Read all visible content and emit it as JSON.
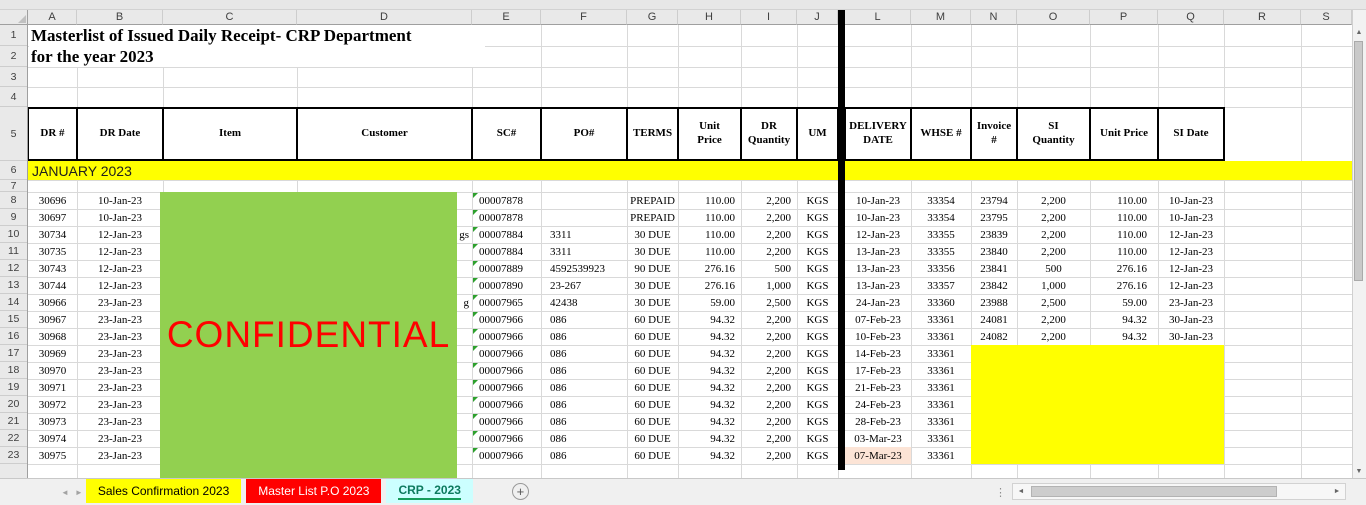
{
  "sheet": {
    "title_line1": "Masterlist of Issued Daily Receipt- CRP Department",
    "title_line2": "for the year 2023",
    "section_header": "JANUARY 2023",
    "confidential_text": "CONFIDENTIAL",
    "column_letters": [
      "A",
      "B",
      "C",
      "D",
      "E",
      "F",
      "G",
      "H",
      "I",
      "J",
      "L",
      "M",
      "N",
      "O",
      "P",
      "Q",
      "R",
      "S"
    ],
    "row_numbers": [
      "1",
      "2",
      "3",
      "4",
      "5",
      "6",
      "7",
      "8",
      "9",
      "10",
      "11",
      "12",
      "13",
      "14",
      "15",
      "16",
      "17",
      "18",
      "19",
      "20",
      "21",
      "22",
      "23"
    ],
    "headers": {
      "dr": "DR #",
      "dr_date": "DR Date",
      "item": "Item",
      "customer": "Customer",
      "sc": "SC#",
      "po": "PO#",
      "terms": "TERMS",
      "unit_price": "Unit\nPrice",
      "dr_qty": "DR\nQuantity",
      "um": "UM",
      "delivery_date": "DELIVERY\nDATE",
      "whse": "WHSE #",
      "invoice": "Invoice\n#",
      "si_qty": "SI\nQuantity",
      "si_unit_price": "Unit Price",
      "si_date": "SI Date"
    },
    "records": [
      {
        "row": "8",
        "dr": "30696",
        "dr_date": "10-Jan-23",
        "sc": "00007878",
        "po": "",
        "terms": "PREPAID",
        "unit_price": "110.00",
        "dr_qty": "2,200",
        "um": "KGS",
        "delivery_date": "10-Jan-23",
        "whse": "33354",
        "invoice": "23794",
        "si_qty": "2,200",
        "si_unit_price": "110.00",
        "si_date": "10-Jan-23"
      },
      {
        "row": "9",
        "dr": "30697",
        "dr_date": "10-Jan-23",
        "sc": "00007878",
        "po": "",
        "terms": "PREPAID",
        "unit_price": "110.00",
        "dr_qty": "2,200",
        "um": "KGS",
        "delivery_date": "10-Jan-23",
        "whse": "33354",
        "invoice": "23795",
        "si_qty": "2,200",
        "si_unit_price": "110.00",
        "si_date": "10-Jan-23"
      },
      {
        "row": "10",
        "dr": "30734",
        "dr_date": "12-Jan-23",
        "customer_tail": "gs",
        "sc": "00007884",
        "po": "3311",
        "terms": "30 DUE",
        "unit_price": "110.00",
        "dr_qty": "2,200",
        "um": "KGS",
        "delivery_date": "12-Jan-23",
        "whse": "33355",
        "invoice": "23839",
        "si_qty": "2,200",
        "si_unit_price": "110.00",
        "si_date": "12-Jan-23"
      },
      {
        "row": "11",
        "dr": "30735",
        "dr_date": "12-Jan-23",
        "sc": "00007884",
        "po": "3311",
        "terms": "30 DUE",
        "unit_price": "110.00",
        "dr_qty": "2,200",
        "um": "KGS",
        "delivery_date": "13-Jan-23",
        "whse": "33355",
        "invoice": "23840",
        "si_qty": "2,200",
        "si_unit_price": "110.00",
        "si_date": "12-Jan-23"
      },
      {
        "row": "12",
        "dr": "30743",
        "dr_date": "12-Jan-23",
        "sc": "00007889",
        "po": "4592539923",
        "terms": "90 DUE",
        "unit_price": "276.16",
        "dr_qty": "500",
        "um": "KGS",
        "delivery_date": "13-Jan-23",
        "whse": "33356",
        "invoice": "23841",
        "si_qty": "500",
        "si_unit_price": "276.16",
        "si_date": "12-Jan-23"
      },
      {
        "row": "13",
        "dr": "30744",
        "dr_date": "12-Jan-23",
        "sc": "00007890",
        "po": "23-267",
        "terms": "30 DUE",
        "unit_price": "276.16",
        "dr_qty": "1,000",
        "um": "KGS",
        "delivery_date": "13-Jan-23",
        "whse": "33357",
        "invoice": "23842",
        "si_qty": "1,000",
        "si_unit_price": "276.16",
        "si_date": "12-Jan-23"
      },
      {
        "row": "14",
        "dr": "30966",
        "dr_date": "23-Jan-23",
        "customer_tail": "g",
        "sc": "00007965",
        "po": "42438",
        "terms": "30 DUE",
        "unit_price": "59.00",
        "dr_qty": "2,500",
        "um": "KGS",
        "delivery_date": "24-Jan-23",
        "whse": "33360",
        "invoice": "23988",
        "si_qty": "2,500",
        "si_unit_price": "59.00",
        "si_date": "23-Jan-23"
      },
      {
        "row": "15",
        "dr": "30967",
        "dr_date": "23-Jan-23",
        "sc": "00007966",
        "po": "086",
        "terms": "60 DUE",
        "unit_price": "94.32",
        "dr_qty": "2,200",
        "um": "KGS",
        "delivery_date": "07-Feb-23",
        "whse": "33361",
        "invoice": "24081",
        "si_qty": "2,200",
        "si_unit_price": "94.32",
        "si_date": "30-Jan-23"
      },
      {
        "row": "16",
        "dr": "30968",
        "dr_date": "23-Jan-23",
        "sc": "00007966",
        "po": "086",
        "terms": "60 DUE",
        "unit_price": "94.32",
        "dr_qty": "2,200",
        "um": "KGS",
        "delivery_date": "10-Feb-23",
        "whse": "33361",
        "invoice": "24082",
        "si_qty": "2,200",
        "si_unit_price": "94.32",
        "si_date": "30-Jan-23"
      },
      {
        "row": "17",
        "dr": "30969",
        "dr_date": "23-Jan-23",
        "sc": "00007966",
        "po": "086",
        "terms": "60 DUE",
        "unit_price": "94.32",
        "dr_qty": "2,200",
        "um": "KGS",
        "delivery_date": "14-Feb-23",
        "whse": "33361",
        "invoice": "",
        "si_qty": "",
        "si_unit_price": "",
        "si_date": ""
      },
      {
        "row": "18",
        "dr": "30970",
        "dr_date": "23-Jan-23",
        "sc": "00007966",
        "po": "086",
        "terms": "60 DUE",
        "unit_price": "94.32",
        "dr_qty": "2,200",
        "um": "KGS",
        "delivery_date": "17-Feb-23",
        "whse": "33361",
        "invoice": "",
        "si_qty": "",
        "si_unit_price": "",
        "si_date": ""
      },
      {
        "row": "19",
        "dr": "30971",
        "dr_date": "23-Jan-23",
        "sc": "00007966",
        "po": "086",
        "terms": "60 DUE",
        "unit_price": "94.32",
        "dr_qty": "2,200",
        "um": "KGS",
        "delivery_date": "21-Feb-23",
        "whse": "33361",
        "invoice": "",
        "si_qty": "",
        "si_unit_price": "",
        "si_date": ""
      },
      {
        "row": "20",
        "dr": "30972",
        "dr_date": "23-Jan-23",
        "sc": "00007966",
        "po": "086",
        "terms": "60 DUE",
        "unit_price": "94.32",
        "dr_qty": "2,200",
        "um": "KGS",
        "delivery_date": "24-Feb-23",
        "whse": "33361",
        "invoice": "",
        "si_qty": "",
        "si_unit_price": "",
        "si_date": ""
      },
      {
        "row": "21",
        "dr": "30973",
        "dr_date": "23-Jan-23",
        "sc": "00007966",
        "po": "086",
        "terms": "60 DUE",
        "unit_price": "94.32",
        "dr_qty": "2,200",
        "um": "KGS",
        "delivery_date": "28-Feb-23",
        "whse": "33361",
        "invoice": "",
        "si_qty": "",
        "si_unit_price": "",
        "si_date": ""
      },
      {
        "row": "22",
        "dr": "30974",
        "dr_date": "23-Jan-23",
        "sc": "00007966",
        "po": "086",
        "terms": "60 DUE",
        "unit_price": "94.32",
        "dr_qty": "2,200",
        "um": "KGS",
        "delivery_date": "03-Mar-23",
        "whse": "33361",
        "invoice": "",
        "si_qty": "",
        "si_unit_price": "",
        "si_date": ""
      },
      {
        "row": "23",
        "dr": "30975",
        "dr_date": "23-Jan-23",
        "sc": "00007966",
        "po": "086",
        "terms": "60 DUE",
        "unit_price": "94.32",
        "dr_qty": "2,200",
        "um": "KGS",
        "delivery_date": "07-Mar-23",
        "delivery_highlight": true,
        "whse": "33361",
        "invoice": "",
        "si_qty": "",
        "si_unit_price": "",
        "si_date": ""
      }
    ]
  },
  "tabs": [
    {
      "label": "Sales Confirmation 2023",
      "color": "#ffff00"
    },
    {
      "label": "Master List P.O 2023",
      "color": "#ff0000"
    },
    {
      "label": "CRP - 2023",
      "color": "#ccffff",
      "active": true
    }
  ],
  "icons": {
    "scroll_up": "▲",
    "scroll_down": "▼",
    "scroll_left": "◄",
    "scroll_right": "►",
    "nav_left": "◄",
    "nav_right": "►",
    "new_sheet": "+",
    "grip": "⋮"
  },
  "colors": {
    "section_fill": "#ffff00",
    "masked_fill": "#ffff00",
    "confidential_fill": "#92d050",
    "confidential_text_color": "#ff0000",
    "highlight_cell_fill": "#fce4d6",
    "tab_active_text": "#0c7a5e",
    "tab_active_underline": "#149c5b",
    "hidden_column_divider": "#000000"
  }
}
